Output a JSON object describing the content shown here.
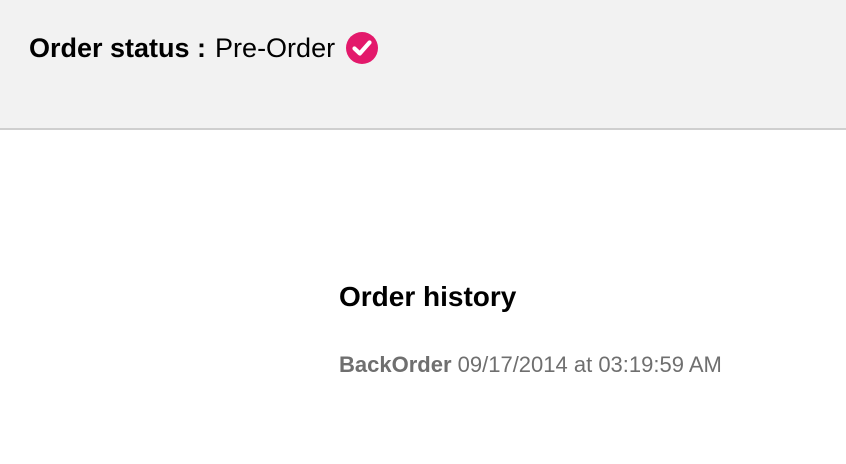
{
  "order_status": {
    "label": "Order status :",
    "value": "Pre-Order",
    "icon": "check-circle-icon",
    "icon_color": "#e3196b"
  },
  "history": {
    "title": "Order history",
    "entries": [
      {
        "status": "BackOrder",
        "timestamp": "09/17/2014 at 03:19:59 AM"
      }
    ]
  }
}
